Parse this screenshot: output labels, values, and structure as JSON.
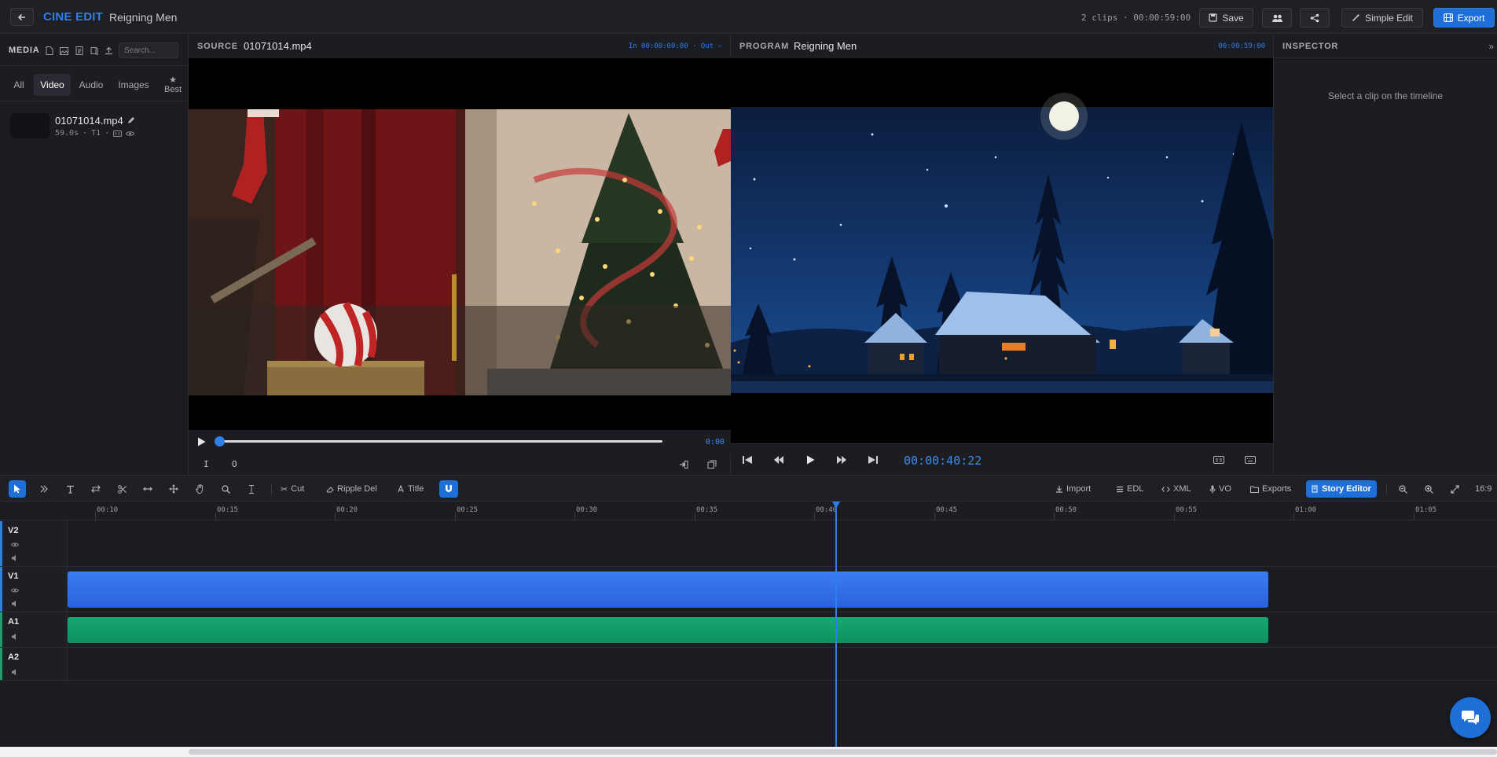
{
  "header": {
    "logo": "CINE EDIT",
    "project_title": "Reigning Men",
    "clip_summary": "2 clips · 00:00:59:00",
    "save_label": "Save",
    "simple_edit_label": "Simple Edit",
    "export_label": "Export"
  },
  "media": {
    "label": "MEDIA",
    "search_placeholder": "Search...",
    "tabs": [
      "All",
      "Video",
      "Audio",
      "Images",
      "Best"
    ],
    "active_tab": "Video",
    "items": [
      {
        "name": "01071014.mp4",
        "duration": "59.0s",
        "track": "T1"
      }
    ]
  },
  "source": {
    "label": "SOURCE",
    "filename": "01071014.mp4",
    "in_out": "In 00:00:00:00 · Out —",
    "time": "0:00",
    "mark_in": "I",
    "mark_out": "O",
    "progress": 0
  },
  "program": {
    "label": "PROGRAM",
    "title": "Reigning Men",
    "duration": "00:00:59:00",
    "timecode": "00:00:40:22"
  },
  "inspector": {
    "label": "INSPECTOR",
    "empty_message": "Select a clip on the timeline"
  },
  "toolbar": {
    "cut": "Cut",
    "ripple_delete": "Ripple Del",
    "title": "Title",
    "import": "Import",
    "edl": "EDL",
    "xml": "XML",
    "vo": "VO",
    "exports": "Exports",
    "story_editor": "Story Editor",
    "aspect": "16:9"
  },
  "timeline": {
    "ruler": [
      "00:10",
      "00:15",
      "00:20",
      "00:25",
      "00:30",
      "00:35",
      "00:40",
      "00:45",
      "00:50",
      "00:55",
      "01:00",
      "01:05"
    ],
    "tracks": [
      "V2",
      "V1",
      "A1",
      "A2"
    ],
    "playhead_time": "00:00:40:22"
  },
  "colors": {
    "accent": "#2f7fe8",
    "video_clip": "#3272e8",
    "audio_clip": "#13a06b",
    "background": "#1c1d22"
  }
}
